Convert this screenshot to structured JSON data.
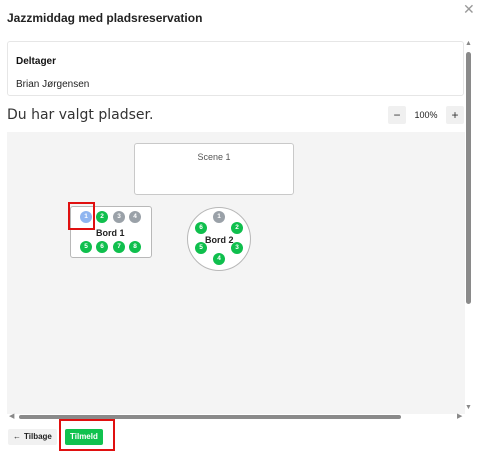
{
  "dialog": {
    "title": "Jazzmiddag med pladsreservation",
    "close_icon": "close-icon"
  },
  "participant": {
    "label": "Deltager",
    "name": "Brian Jørgensen"
  },
  "selection": {
    "heading": "Du har valgt pladser."
  },
  "zoom": {
    "minus": "−",
    "value": "100%",
    "plus": "+"
  },
  "seatmap": {
    "stage_label": "Scene 1",
    "tables": [
      {
        "label": "Bord 1",
        "seats": [
          {
            "number": "1",
            "status": "selected"
          },
          {
            "number": "2",
            "status": "available"
          },
          {
            "number": "3",
            "status": "taken"
          },
          {
            "number": "4",
            "status": "taken"
          },
          {
            "number": "5",
            "status": "available"
          },
          {
            "number": "6",
            "status": "available"
          },
          {
            "number": "7",
            "status": "available"
          },
          {
            "number": "8",
            "status": "available"
          }
        ]
      },
      {
        "label": "Bord 2",
        "seats": [
          {
            "number": "1",
            "status": "taken"
          },
          {
            "number": "2",
            "status": "available"
          },
          {
            "number": "3",
            "status": "available"
          },
          {
            "number": "4",
            "status": "available"
          },
          {
            "number": "5",
            "status": "available"
          },
          {
            "number": "6",
            "status": "available"
          }
        ]
      }
    ],
    "colors": {
      "available": "#0fbf4d",
      "taken": "#9aa1a8",
      "selected": "#8fb5f0"
    }
  },
  "footer": {
    "back_label": "Tilbage",
    "back_icon": "arrow-left-icon",
    "submit_label": "Tilmeld"
  }
}
